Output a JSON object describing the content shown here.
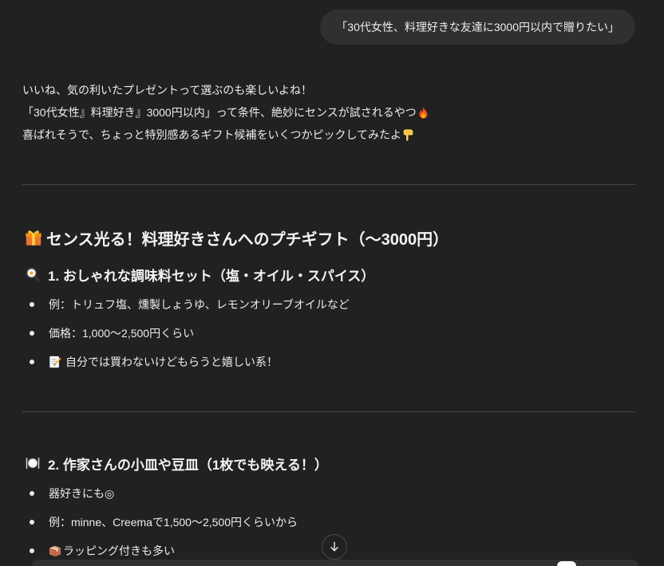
{
  "colors": {
    "background": "#212121",
    "bubble": "#303030",
    "text": "#ececec",
    "divider": "#454545"
  },
  "user_message": {
    "text": "「30代女性、料理好きな友達に3000円以内で贈りたい」"
  },
  "assistant": {
    "intro": [
      {
        "text": "いいね、気の利いたプレゼントって選ぶのも楽しいよね！"
      },
      {
        "text": "「30代女性』料理好き』3000円以内」って条件、絶妙にセンスが試されるやつ",
        "icon": "fire-icon"
      },
      {
        "text": "喜ばれそうで、ちょっと特別感あるギフト候補をいくつかピックしてみたよ",
        "icon": "pointing-down-icon"
      }
    ],
    "heading": {
      "icon": "gift-icon",
      "text": "センス光る！料理好きさんへのプチギフト（〜3000円）"
    },
    "sections": [
      {
        "icon": "fried-egg-pan-icon",
        "title": "1. おしゃれな調味料セット（塩・オイル・スパイス）",
        "bullets": [
          {
            "text": "例：トリュフ塩、燻製しょうゆ、レモンオリーブオイルなど"
          },
          {
            "text": "価格：1,000〜2,500円くらい"
          },
          {
            "icon": "memo-icon",
            "text": "自分では買わないけどもらうと嬉しい系！"
          }
        ]
      },
      {
        "icon": "plate-with-cutlery-icon",
        "title": "2. 作家さんの小皿や豆皿（1枚でも映える！）",
        "bullets": [
          {
            "text": "器好きにも◎"
          },
          {
            "text": "例：minne、Creemaで1,500〜2,500円くらいから"
          },
          {
            "icon": "package-icon",
            "text": "ラッピング付きも多い"
          }
        ]
      }
    ]
  },
  "controls": {
    "scroll_down_icon": "arrow-down-icon"
  }
}
